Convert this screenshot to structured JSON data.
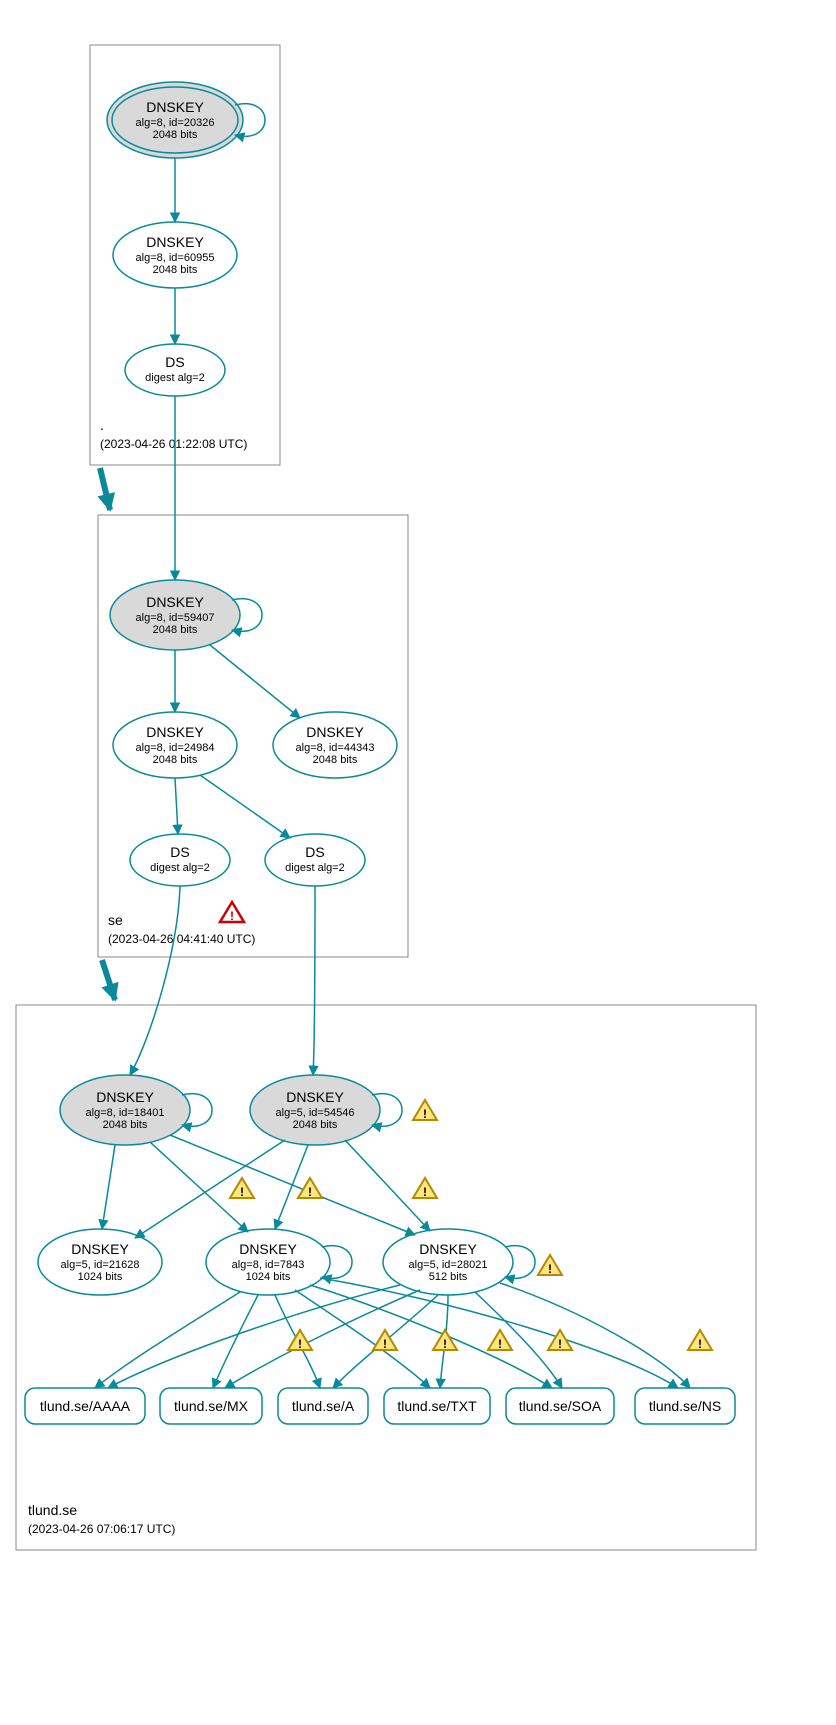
{
  "zones": {
    "root": {
      "label": ".",
      "timestamp": "(2023-04-26 01:22:08 UTC)"
    },
    "se": {
      "label": "se",
      "timestamp": "(2023-04-26 04:41:40 UTC)"
    },
    "tlund": {
      "label": "tlund.se",
      "timestamp": "(2023-04-26 07:06:17 UTC)"
    }
  },
  "nodes": {
    "root_ksk": {
      "title": "DNSKEY",
      "sub1": "alg=8, id=20326",
      "sub2": "2048 bits"
    },
    "root_zsk": {
      "title": "DNSKEY",
      "sub1": "alg=8, id=60955",
      "sub2": "2048 bits"
    },
    "root_ds": {
      "title": "DS",
      "sub1": "digest alg=2"
    },
    "se_ksk": {
      "title": "DNSKEY",
      "sub1": "alg=8, id=59407",
      "sub2": "2048 bits"
    },
    "se_zsk1": {
      "title": "DNSKEY",
      "sub1": "alg=8, id=24984",
      "sub2": "2048 bits"
    },
    "se_zsk2": {
      "title": "DNSKEY",
      "sub1": "alg=8, id=44343",
      "sub2": "2048 bits"
    },
    "se_ds1": {
      "title": "DS",
      "sub1": "digest alg=2"
    },
    "se_ds2": {
      "title": "DS",
      "sub1": "digest alg=2"
    },
    "t_ksk1": {
      "title": "DNSKEY",
      "sub1": "alg=8, id=18401",
      "sub2": "2048 bits"
    },
    "t_ksk2": {
      "title": "DNSKEY",
      "sub1": "alg=5, id=54546",
      "sub2": "2048 bits"
    },
    "t_zsk1": {
      "title": "DNSKEY",
      "sub1": "alg=5, id=21628",
      "sub2": "1024 bits"
    },
    "t_zsk2": {
      "title": "DNSKEY",
      "sub1": "alg=8, id=7843",
      "sub2": "1024 bits"
    },
    "t_zsk3": {
      "title": "DNSKEY",
      "sub1": "alg=5, id=28021",
      "sub2": "512 bits"
    },
    "rr_aaaa": {
      "title": "tlund.se/AAAA"
    },
    "rr_mx": {
      "title": "tlund.se/MX"
    },
    "rr_a": {
      "title": "tlund.se/A"
    },
    "rr_txt": {
      "title": "tlund.se/TXT"
    },
    "rr_soa": {
      "title": "tlund.se/SOA"
    },
    "rr_ns": {
      "title": "tlund.se/NS"
    }
  },
  "chart_data": {
    "type": "diagram",
    "description": "DNSSEC delegation/authentication graph (DNSViz-style) for tlund.se, showing chain of trust from root (.) through se to tlund.se with DNSKEY/DS records and RRset leaves, with warning and error markers.",
    "zones": [
      {
        "name": ".",
        "timestamp": "2023-04-26 01:22:08 UTC"
      },
      {
        "name": "se",
        "timestamp": "2023-04-26 04:41:40 UTC"
      },
      {
        "name": "tlund.se",
        "timestamp": "2023-04-26 07:06:17 UTC"
      }
    ],
    "nodes": [
      {
        "id": "root_ksk",
        "zone": ".",
        "type": "DNSKEY",
        "alg": 8,
        "key_id": 20326,
        "bits": 2048,
        "role": "KSK",
        "trust_anchor": true,
        "self_signed": true
      },
      {
        "id": "root_zsk",
        "zone": ".",
        "type": "DNSKEY",
        "alg": 8,
        "key_id": 60955,
        "bits": 2048,
        "role": "ZSK"
      },
      {
        "id": "root_ds",
        "zone": ".",
        "type": "DS",
        "digest_alg": 2,
        "delegates_to": "se"
      },
      {
        "id": "se_ksk",
        "zone": "se",
        "type": "DNSKEY",
        "alg": 8,
        "key_id": 59407,
        "bits": 2048,
        "role": "KSK",
        "self_signed": true
      },
      {
        "id": "se_zsk1",
        "zone": "se",
        "type": "DNSKEY",
        "alg": 8,
        "key_id": 24984,
        "bits": 2048,
        "role": "ZSK"
      },
      {
        "id": "se_zsk2",
        "zone": "se",
        "type": "DNSKEY",
        "alg": 8,
        "key_id": 44343,
        "bits": 2048,
        "role": "ZSK"
      },
      {
        "id": "se_ds1",
        "zone": "se",
        "type": "DS",
        "digest_alg": 2,
        "delegates_to": "tlund.se",
        "status": "error"
      },
      {
        "id": "se_ds2",
        "zone": "se",
        "type": "DS",
        "digest_alg": 2,
        "delegates_to": "tlund.se"
      },
      {
        "id": "t_ksk1",
        "zone": "tlund.se",
        "type": "DNSKEY",
        "alg": 8,
        "key_id": 18401,
        "bits": 2048,
        "role": "KSK",
        "self_signed": true
      },
      {
        "id": "t_ksk2",
        "zone": "tlund.se",
        "type": "DNSKEY",
        "alg": 5,
        "key_id": 54546,
        "bits": 2048,
        "role": "KSK",
        "self_signed": true,
        "status": "warning"
      },
      {
        "id": "t_zsk1",
        "zone": "tlund.se",
        "type": "DNSKEY",
        "alg": 5,
        "key_id": 21628,
        "bits": 1024
      },
      {
        "id": "t_zsk2",
        "zone": "tlund.se",
        "type": "DNSKEY",
        "alg": 8,
        "key_id": 7843,
        "bits": 1024,
        "self_signed": true,
        "status": "warning"
      },
      {
        "id": "t_zsk3",
        "zone": "tlund.se",
        "type": "DNSKEY",
        "alg": 5,
        "key_id": 28021,
        "bits": 512,
        "self_signed": true,
        "status": "warning"
      },
      {
        "id": "rr_aaaa",
        "zone": "tlund.se",
        "type": "RRset",
        "name": "tlund.se",
        "rrtype": "AAAA"
      },
      {
        "id": "rr_mx",
        "zone": "tlund.se",
        "type": "RRset",
        "name": "tlund.se",
        "rrtype": "MX"
      },
      {
        "id": "rr_a",
        "zone": "tlund.se",
        "type": "RRset",
        "name": "tlund.se",
        "rrtype": "A"
      },
      {
        "id": "rr_txt",
        "zone": "tlund.se",
        "type": "RRset",
        "name": "tlund.se",
        "rrtype": "TXT"
      },
      {
        "id": "rr_soa",
        "zone": "tlund.se",
        "type": "RRset",
        "name": "tlund.se",
        "rrtype": "SOA"
      },
      {
        "id": "rr_ns",
        "zone": "tlund.se",
        "type": "RRset",
        "name": "tlund.se",
        "rrtype": "NS"
      }
    ],
    "edges": [
      {
        "from": "root_ksk",
        "to": "root_ksk",
        "kind": "self-sig"
      },
      {
        "from": "root_ksk",
        "to": "root_zsk"
      },
      {
        "from": "root_zsk",
        "to": "root_ds"
      },
      {
        "from": "root_ds",
        "to": "se_ksk"
      },
      {
        "from": "se_ksk",
        "to": "se_ksk",
        "kind": "self-sig"
      },
      {
        "from": "se_ksk",
        "to": "se_zsk1"
      },
      {
        "from": "se_ksk",
        "to": "se_zsk2"
      },
      {
        "from": "se_zsk1",
        "to": "se_ds1"
      },
      {
        "from": "se_zsk1",
        "to": "se_ds2"
      },
      {
        "from": "se_ds1",
        "to": "t_ksk1"
      },
      {
        "from": "se_ds2",
        "to": "t_ksk2"
      },
      {
        "from": "t_ksk1",
        "to": "t_ksk1",
        "kind": "self-sig"
      },
      {
        "from": "t_ksk2",
        "to": "t_ksk2",
        "kind": "self-sig"
      },
      {
        "from": "t_ksk1",
        "to": "t_zsk1"
      },
      {
        "from": "t_ksk1",
        "to": "t_zsk2",
        "status": "warning"
      },
      {
        "from": "t_ksk1",
        "to": "t_zsk3",
        "status": "warning"
      },
      {
        "from": "t_ksk2",
        "to": "t_zsk1"
      },
      {
        "from": "t_ksk2",
        "to": "t_zsk2",
        "status": "warning"
      },
      {
        "from": "t_ksk2",
        "to": "t_zsk3",
        "status": "warning"
      },
      {
        "from": "t_zsk2",
        "to": "t_zsk2",
        "kind": "self-sig"
      },
      {
        "from": "t_zsk3",
        "to": "t_zsk3",
        "kind": "self-sig"
      },
      {
        "from": "t_zsk2",
        "to": "rr_aaaa"
      },
      {
        "from": "t_zsk2",
        "to": "rr_mx"
      },
      {
        "from": "t_zsk2",
        "to": "rr_a"
      },
      {
        "from": "t_zsk2",
        "to": "rr_txt"
      },
      {
        "from": "t_zsk2",
        "to": "rr_soa"
      },
      {
        "from": "t_zsk2",
        "to": "rr_ns"
      },
      {
        "from": "t_zsk3",
        "to": "rr_aaaa"
      },
      {
        "from": "t_zsk3",
        "to": "rr_mx",
        "status": "warning"
      },
      {
        "from": "t_zsk3",
        "to": "rr_a",
        "status": "warning"
      },
      {
        "from": "t_zsk3",
        "to": "rr_txt",
        "status": "warning"
      },
      {
        "from": "t_zsk3",
        "to": "rr_soa",
        "status": "warning"
      },
      {
        "from": "t_zsk3",
        "to": "rr_ns",
        "status": "warning"
      }
    ]
  }
}
